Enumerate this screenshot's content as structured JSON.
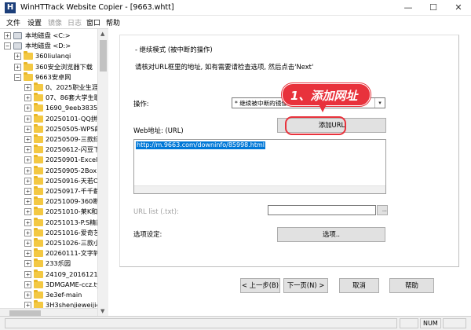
{
  "window": {
    "title": "WinHTTrack Website Copier - [9663.whtt]",
    "icon_letter": "H",
    "minimize": "—",
    "maximize": "☐",
    "close": "✕"
  },
  "menu": {
    "file": "文件",
    "settings": "设置",
    "mirror": "镜像",
    "log": "日志",
    "window": "窗口",
    "help": "帮助"
  },
  "tree": {
    "rows": [
      {
        "label": "本地磁盘 <C:>",
        "expander": "+",
        "kind": "drive"
      },
      {
        "label": "本地磁盘 <D:>",
        "expander": "−",
        "kind": "drive"
      },
      {
        "label": "360liulanqi",
        "expander": "+",
        "kind": "folder"
      },
      {
        "label": "360安全浏览器下载",
        "expander": "+",
        "kind": "folder"
      },
      {
        "label": "9663安卓网",
        "expander": "−",
        "kind": "folder"
      },
      {
        "label": "0、2025职业生涯规",
        "expander": "+",
        "kind": "folder"
      },
      {
        "label": "07、86套大学生职业",
        "expander": "+",
        "kind": "folder"
      },
      {
        "label": "1690_9eeb383568",
        "expander": "+",
        "kind": "folder"
      },
      {
        "label": "20250101-QQ拼音",
        "expander": "+",
        "kind": "folder"
      },
      {
        "label": "20250505-WPS邮箱",
        "expander": "+",
        "kind": "folder"
      },
      {
        "label": "20250509-三款绿色",
        "expander": "+",
        "kind": "folder"
      },
      {
        "label": "20250612-闪豆下载",
        "expander": "+",
        "kind": "folder"
      },
      {
        "label": "20250901-Excel聚",
        "expander": "+",
        "kind": "folder"
      },
      {
        "label": "20250905-2Box",
        "expander": "+",
        "kind": "folder"
      },
      {
        "label": "20250916-天若OCR",
        "expander": "+",
        "kind": "folder"
      },
      {
        "label": "20250917-千千静听",
        "expander": "+",
        "kind": "folder"
      },
      {
        "label": "20251009-360断网",
        "expander": "+",
        "kind": "folder"
      },
      {
        "label": "20251010-莱K和网",
        "expander": "+",
        "kind": "folder"
      },
      {
        "label": "20251013-P.S精简版",
        "expander": "+",
        "kind": "folder"
      },
      {
        "label": "20251016-爱奇艺播",
        "expander": "+",
        "kind": "folder"
      },
      {
        "label": "20251026-三款小工",
        "expander": "+",
        "kind": "folder"
      },
      {
        "label": "20260111-文字转语",
        "expander": "+",
        "kind": "folder"
      },
      {
        "label": "233乐园",
        "expander": "+",
        "kind": "folder"
      },
      {
        "label": "24109_2016121113",
        "expander": "+",
        "kind": "folder"
      },
      {
        "label": "3DMGAME-ccz.tyt",
        "expander": "+",
        "kind": "folder"
      },
      {
        "label": "3e3ef-main",
        "expander": "+",
        "kind": "folder"
      },
      {
        "label": "3H3shenjieweiji4.7",
        "expander": "+",
        "kind": "folder"
      }
    ]
  },
  "wizard": {
    "heading": "- 继续模式 (被中断的操作)",
    "instruction": "请核对URL框里的地址, 如有需要请检查选项, 然后点击'Next'",
    "action_label": "操作:",
    "action_value": "* 继续被中断的镜像",
    "action_arrow": "▾",
    "add_url_button": "添加URL",
    "web_address_label": "Web地址: (URL)",
    "url_value": "http://m.9663.com/downinfo/85998.html",
    "url_list_label": "URL list (.txt):",
    "browse_button": "...",
    "options_label": "选项设定:",
    "options_button": "选项..",
    "back_button": "< 上一步(B)",
    "next_button": "下一页(N) >",
    "cancel_button": "取消",
    "help_button": "帮助"
  },
  "annotation": {
    "callout": "1、添加网址"
  },
  "status": {
    "num": "NUM"
  }
}
